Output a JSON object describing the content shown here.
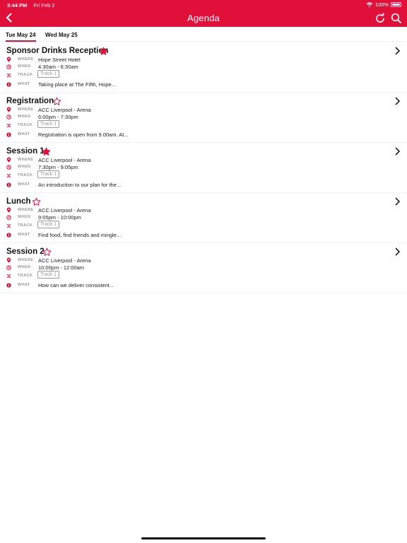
{
  "status": {
    "time": "3:44 PM",
    "date": "Fri Feb 2",
    "battery": "100%"
  },
  "header": {
    "title": "Agenda",
    "icons": [
      "back-icon",
      "refresh-icon",
      "search-icon"
    ]
  },
  "tabs": [
    {
      "label": "Tue May 24",
      "active": true
    },
    {
      "label": "Wed May 25",
      "active": false
    }
  ],
  "labels": {
    "where": "WHERE",
    "when": "WHEN",
    "track": "TRACK",
    "what": "WHAT"
  },
  "colors": {
    "accent": "#e0103a"
  },
  "sessions": [
    {
      "name": "Sponsor Drinks Reception",
      "starred": true,
      "where": "Hope Street Hotel",
      "when": "4:30am - 6:30am",
      "track": "Track 1",
      "what": "Taking place at The Fifth, Hope..."
    },
    {
      "name": "Registration",
      "starred": false,
      "where": "ACC Liverpool - Arena",
      "when": "6:00pm - 7:30pm",
      "track": "Track 1",
      "what": "Registration is open from 9.00am. At..."
    },
    {
      "name": "Session 1",
      "starred": true,
      "where": "ACC Liverpool - Arena",
      "when": "7:30pm - 9:05pm",
      "track": "Track 1",
      "what": "An introduction to our plan for the..."
    },
    {
      "name": "Lunch",
      "starred": false,
      "where": "ACC Liverpool - Arena",
      "when": "9:05pm - 10:00pm",
      "track": "Track 1",
      "what": "Find food, find friends and mingle..."
    },
    {
      "name": "Session 2",
      "starred": false,
      "where": "ACC Liverpool - Arena",
      "when": "10:00pm - 12:00am",
      "track": "Track 1",
      "what": "How can we deliver consistent..."
    }
  ]
}
